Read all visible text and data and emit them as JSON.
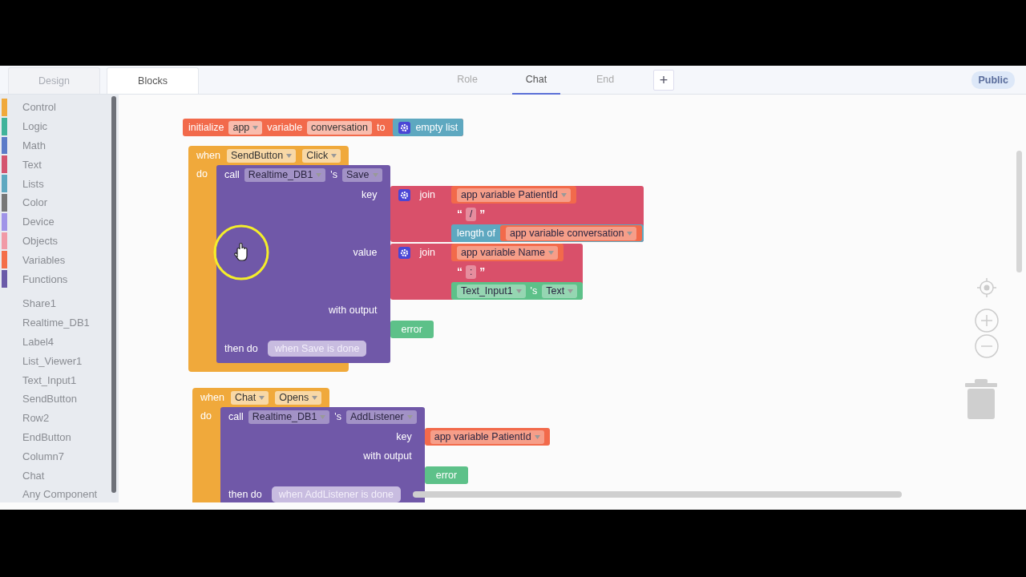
{
  "header": {
    "mode_tabs": [
      {
        "label": "Design",
        "selected": false,
        "disabled": true
      },
      {
        "label": "Blocks",
        "selected": true,
        "disabled": false
      }
    ],
    "screen_tabs": [
      {
        "label": "Role",
        "selected": false
      },
      {
        "label": "Chat",
        "selected": true
      },
      {
        "label": "End",
        "selected": false
      }
    ],
    "add_screen_button": "+",
    "visibility_badge": "Public"
  },
  "palette": {
    "categories": [
      {
        "label": "Control",
        "color": "#f0a93b"
      },
      {
        "label": "Logic",
        "color": "#3fb39a"
      },
      {
        "label": "Math",
        "color": "#5b7bc8"
      },
      {
        "label": "Text",
        "color": "#d4546f"
      },
      {
        "label": "Lists",
        "color": "#5ea8c0"
      },
      {
        "label": "Color",
        "color": "#777777"
      },
      {
        "label": "Device",
        "color": "#a094e8"
      },
      {
        "label": "Objects",
        "color": "#f19aa6"
      },
      {
        "label": "Variables",
        "color": "#f46e48"
      },
      {
        "label": "Functions",
        "color": "#6a5aa8"
      }
    ],
    "components": [
      "Share1",
      "Realtime_DB1",
      "Label4",
      "List_Viewer1",
      "Text_Input1",
      "SendButton",
      "Row2",
      "EndButton",
      "Column7",
      "Chat",
      "Any Component"
    ]
  },
  "workspace": {
    "blocks": [
      {
        "kind": "initialize",
        "label": "initialize",
        "scope": {
          "text": "app",
          "dropdown": true
        },
        "variable_label": "variable",
        "name": {
          "text": "conversation",
          "dropdown": false
        },
        "to_label": "to",
        "value": {
          "kind": "list",
          "label": "empty list"
        }
      },
      {
        "kind": "event",
        "when_label": "when",
        "component": {
          "text": "SendButton",
          "dropdown": true
        },
        "event": {
          "text": "Click",
          "dropdown": true
        },
        "do_label": "do",
        "call": {
          "call_label": "call",
          "component": {
            "text": "Realtime_DB1",
            "dropdown": true
          },
          "possessive": "'s",
          "method": {
            "text": "Save",
            "dropdown": true
          },
          "params": [
            {
              "label": "key",
              "value": {
                "kind": "join",
                "label": "join",
                "items": [
                  {
                    "kind": "variable",
                    "field": {
                      "text": "app variable PatientId",
                      "dropdown": true
                    }
                  },
                  {
                    "kind": "text",
                    "open": "“",
                    "field": {
                      "text": "/",
                      "dropdown": false
                    },
                    "close": "”"
                  },
                  {
                    "kind": "length",
                    "label": "length of",
                    "arg": {
                      "kind": "variable",
                      "field": {
                        "text": "app variable conversation",
                        "dropdown": true
                      }
                    }
                  }
                ]
              }
            },
            {
              "label": "value",
              "value": {
                "kind": "join",
                "label": "join",
                "items": [
                  {
                    "kind": "variable",
                    "field": {
                      "text": "app variable Name",
                      "dropdown": true
                    }
                  },
                  {
                    "kind": "text",
                    "open": "“",
                    "field": {
                      "text": ":",
                      "dropdown": false
                    },
                    "close": "”"
                  },
                  {
                    "kind": "property",
                    "component": {
                      "text": "Text_Input1",
                      "dropdown": true
                    },
                    "possessive": "'s",
                    "property": {
                      "text": "Text",
                      "dropdown": true
                    }
                  }
                ]
              }
            }
          ],
          "output_label": "with output",
          "output": {
            "kind": "error",
            "label": "error"
          },
          "then_label": "then do",
          "callback": "when Save is done"
        }
      },
      {
        "kind": "event",
        "when_label": "when",
        "component": {
          "text": "Chat",
          "dropdown": true
        },
        "event": {
          "text": "Opens",
          "dropdown": true
        },
        "do_label": "do",
        "call": {
          "call_label": "call",
          "component": {
            "text": "Realtime_DB1",
            "dropdown": true
          },
          "possessive": "'s",
          "method": {
            "text": "AddListener",
            "dropdown": true
          },
          "params": [
            {
              "label": "key",
              "value": {
                "kind": "variable",
                "field": {
                  "text": "app variable PatientId",
                  "dropdown": true
                }
              }
            }
          ],
          "output_label": "with output",
          "output": {
            "kind": "error",
            "label": "error"
          },
          "then_label": "then do",
          "callback": "when AddListener is done"
        }
      }
    ]
  }
}
